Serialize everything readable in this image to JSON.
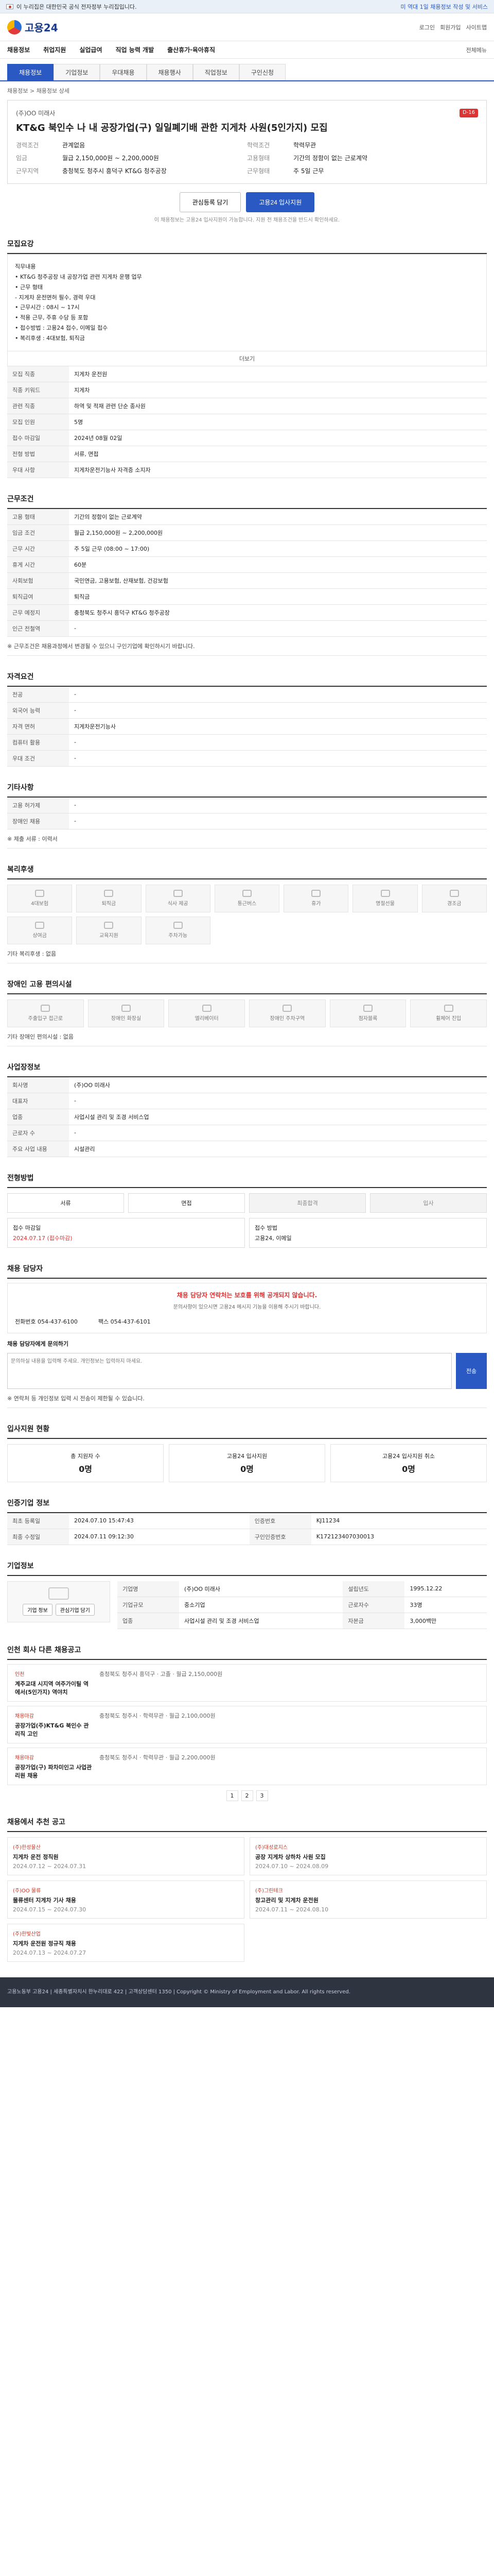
{
  "gov_bar": {
    "text": "이 누리집은 대한민국 공식 전자정부 누리집입니다.",
    "right": "미 역대 1일 채용정보 작성 및 서비스"
  },
  "header": {
    "logo": "고용24",
    "links": [
      "로그인",
      "회원가입",
      "사이트맵"
    ]
  },
  "gnb": {
    "items": [
      "채용정보",
      "취업지원",
      "실업급여",
      "직업 능력 개발",
      "출산휴가·육아휴직"
    ],
    "right": [
      "전체메뉴"
    ]
  },
  "tabs": [
    "채용정보",
    "기업정보",
    "우대채용",
    "채용행사",
    "직업정보",
    "구인신청"
  ],
  "breadcrumb": "채용정보 > 채용정보 상세",
  "job": {
    "company": "(주)OO 미래사",
    "company_right": "D-16",
    "title": "KT&G 북인수 나 내 공장가업(구) 일일폐기배 관한 지게차 사원(5인가지) 모집",
    "summary": [
      {
        "k": "경력조건",
        "v": "관계없음"
      },
      {
        "k": "학력조건",
        "v": "학력무관"
      },
      {
        "k": "임금",
        "v": "월급 2,150,000원 ~ 2,200,000원"
      },
      {
        "k": "고용형태",
        "v": "기간의 정함이 없는 근로계약"
      },
      {
        "k": "근무지역",
        "v": "충청북도 청주시 흥덕구 KT&G 청주공장"
      },
      {
        "k": "근무형태",
        "v": "주 5일 근무"
      }
    ],
    "save_label": "관심등록 담기",
    "apply_label": "고용24 입사지원",
    "note": "이 채용정보는 고용24 입사지원이 가능합니다. 지원 전 채용조건을 반드시 확인하세요."
  },
  "sections": {
    "recruit": {
      "title": "모집요강",
      "desc": "직무내용\n• KT&G 청주공장 내 공장가업 관련 지게차 운행 업무\n• 근무 형태\n  - 지게차 운전면허 필수, 경력 우대\n• 근무시간 : 08시 ~ 17시\n• 적용 근무, 주휴 수당 등 포함\n• 접수방법 : 고용24 접수, 이메일 접수\n• 복리후생 : 4대보험, 퇴직금",
      "more_label": "더보기",
      "rows": [
        {
          "k": "모집 직종",
          "v": "지게차 운전원"
        },
        {
          "k": "직종 키워드",
          "v": "지게차"
        },
        {
          "k": "관련 직종",
          "v": "하역 및 적재 관련 단순 종사원"
        },
        {
          "k": "모집 인원",
          "v": "5명"
        },
        {
          "k": "접수 마감일",
          "v": "2024년 08월 02일"
        },
        {
          "k": "전형 방법",
          "v": "서류, 면접"
        },
        {
          "k": "우대 사항",
          "v": "지게차운전기능사 자격증 소지자"
        }
      ]
    },
    "conditions": {
      "title": "근무조건",
      "rows": [
        {
          "k": "고용 형태",
          "v": "기간의 정함이 없는 근로계약"
        },
        {
          "k": "임금 조건",
          "v": "월급 2,150,000원 ~ 2,200,000원"
        },
        {
          "k": "근무 시간",
          "v": "주 5일 근무 (08:00 ~ 17:00)"
        },
        {
          "k": "휴게 시간",
          "v": "60분"
        },
        {
          "k": "사회보험",
          "v": "국민연금, 고용보험, 산재보험, 건강보험"
        },
        {
          "k": "퇴직급여",
          "v": "퇴직금"
        },
        {
          "k": "근무 예정지",
          "v": "충청북도 청주시 흥덕구 KT&G 청주공장"
        },
        {
          "k": "인근 전철역",
          "v": "-"
        }
      ],
      "note": "※ 근무조건은 채용과정에서 변경될 수 있으니 구인기업에 확인하시기 바랍니다."
    },
    "eligibility": {
      "title": "자격요건",
      "rows": [
        {
          "k": "전공",
          "v": "-"
        },
        {
          "k": "외국어 능력",
          "v": "-"
        },
        {
          "k": "자격 면허",
          "v": "지게차운전기능사"
        },
        {
          "k": "컴퓨터 활용",
          "v": "-"
        },
        {
          "k": "우대 조건",
          "v": "-"
        }
      ]
    },
    "employer_info": {
      "title": "기타사항",
      "rows": [
        {
          "k": "고용 허가제",
          "v": "-"
        },
        {
          "k": "장애인 채용",
          "v": "-"
        }
      ],
      "extra": "※ 제출 서류 : 이력서"
    },
    "welfare": {
      "title": "복리후생",
      "items": [
        "4대보험",
        "퇴직금",
        "식사 제공",
        "통근버스",
        "휴가",
        "명절선물",
        "경조금",
        "상여금",
        "교육지원",
        "주차가능"
      ],
      "extra": "기타 복리후생 : 없음"
    },
    "disability": {
      "title": "장애인 고용 편의시설",
      "items": [
        "주출입구 접근로",
        "장애인 화장실",
        "엘리베이터",
        "장애인 주차구역",
        "점자블록",
        "휠체어 진입"
      ],
      "extra": "기타 장애인 편의시설 : 없음"
    },
    "workplace": {
      "title": "사업장정보",
      "rows": [
        {
          "k": "회사명",
          "v": "(주)OO 미래사"
        },
        {
          "k": "대표자",
          "v": "-"
        },
        {
          "k": "업종",
          "v": "사업시설 관리 및 조경 서비스업"
        },
        {
          "k": "근로자 수",
          "v": "-"
        },
        {
          "k": "주요 사업 내용",
          "v": "시설관리"
        }
      ]
    },
    "process": {
      "title": "전형방법",
      "steps": [
        "서류",
        "면접",
        "최종합격",
        "입사"
      ],
      "apply_title": "접수 마감일",
      "deadline": "2024.07.17 (접수마감)",
      "apply_method_title": "접수 방법",
      "apply_method": "고용24, 이메일"
    },
    "contact": {
      "title": "채용 담당자",
      "warning": "채용 담당자 연락처는 보호를 위해 공개되지 않습니다.",
      "warning_sub": "문의사항이 있으시면 고용24 메시지 기능을 이용해 주시기 바랍니다.",
      "phone_label": "전화번호",
      "phone": "054-437-6100",
      "fax_label": "팩스",
      "fax": "054-437-6101",
      "msg_title": "채용 담당자에게 문의하기",
      "msg_placeholder": "문의하실 내용을 입력해 주세요. 개인정보는 입력하지 마세요.",
      "msg_button": "전송",
      "msg_note": "※ 연락처 등 개인정보 입력 시 전송이 제한될 수 있습니다."
    },
    "applicants": {
      "title": "입사지원 현황",
      "stats": [
        {
          "label": "총 지원자 수",
          "value": "0명"
        },
        {
          "label": "고용24 입사지원",
          "value": "0명"
        },
        {
          "label": "고용24 입사지원 취소",
          "value": "0명"
        }
      ]
    },
    "certified": {
      "title": "인증기업 정보",
      "rows": [
        {
          "k": "최초 등록일",
          "v": "2024.07.10 15:47:43"
        },
        {
          "k": "인증번호",
          "v": "KJ11234"
        },
        {
          "k": "최종 수정일",
          "v": "2024.07.11 09:12:30"
        },
        {
          "k": "구인인증번호",
          "v": "K172123407030013"
        }
      ]
    },
    "company": {
      "title": "기업정보",
      "rows": [
        {
          "k": "기업명",
          "v": "(주)OO 미래사"
        },
        {
          "k": "설립년도",
          "v": "1995.12.22"
        },
        {
          "k": "기업규모",
          "v": "중소기업"
        },
        {
          "k": "근로자수",
          "v": "33명"
        },
        {
          "k": "업종",
          "v": "사업시설 관리 및 조경 서비스업"
        },
        {
          "k": "자본금",
          "v": "3,000백만"
        }
      ],
      "buttons": [
        "기업 정보",
        "관심기업 담기"
      ]
    },
    "same_job": {
      "title": "인천 회사 다른 채용공고",
      "items": [
        {
          "tag": "인천",
          "name": "계주교대 시지역 여주가이틸 역에서(5인가지) 역야치",
          "info": "충청북도 청주시 흥덕구 · 고졸 · 월급 2,150,000원"
        },
        {
          "tag": "채용마감",
          "name": "공장가업(주)KT&G 북인수 관리직 고인",
          "info": "충청북도 청주시 · 학력무관 · 월급 2,100,000원"
        },
        {
          "tag": "채용마감",
          "name": "공장가업(구) 파차미인고 사업관리원 채용",
          "info": "충청북도 청주시 · 학력무관 · 월급 2,200,000원"
        }
      ],
      "pager": [
        "1",
        "2",
        "3"
      ]
    },
    "similar": {
      "title": "채용에서 추천 공고",
      "items": [
        {
          "tag": "(주)한성물산",
          "title": "지게차 운전 정직원",
          "period": "2024.07.12 ~ 2024.07.31"
        },
        {
          "tag": "(주)대성로지스",
          "title": "공장 지게차 상하차 사원 모집",
          "period": "2024.07.10 ~ 2024.08.09"
        },
        {
          "tag": "(주)OO 물류",
          "title": "물류센터 지게차 기사 채용",
          "period": "2024.07.15 ~ 2024.07.30"
        },
        {
          "tag": "(주)그린테크",
          "title": "창고관리 및 지게차 운전원",
          "period": "2024.07.11 ~ 2024.08.10"
        },
        {
          "tag": "(주)한빛산업",
          "title": "지게차 운전원 정규직 채용",
          "period": "2024.07.13 ~ 2024.07.27"
        }
      ]
    }
  },
  "footer": {
    "text": "고용노동부 고용24 | 세종특별자치시 한누리대로 422 | 고객상담센터 1350 | Copyright © Ministry of Employment and Labor. All rights reserved."
  }
}
